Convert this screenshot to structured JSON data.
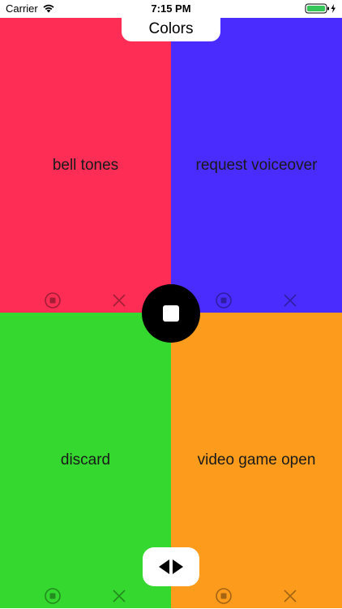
{
  "status_bar": {
    "carrier": "Carrier",
    "time": "7:15 PM",
    "icons": [
      "wifi-icon",
      "battery-icon",
      "charging-bolt-icon"
    ]
  },
  "title": "Colors",
  "quadrants": [
    {
      "label": "bell tones",
      "color": "#fe2d55",
      "icons": [
        "record-icon",
        "close-icon"
      ]
    },
    {
      "label": "request voiceover",
      "color": "#4a2dfe",
      "icons": [
        "record-icon",
        "close-icon"
      ]
    },
    {
      "label": "discard",
      "color": "#35d82f",
      "icons": [
        "record-icon",
        "close-icon"
      ]
    },
    {
      "label": "video game open",
      "color": "#fd9b1c",
      "icons": [
        "record-icon",
        "close-icon"
      ]
    }
  ],
  "controls": {
    "center_button_icon": "stop-icon",
    "bottom_button_icon": "swap-arrows-icon"
  }
}
